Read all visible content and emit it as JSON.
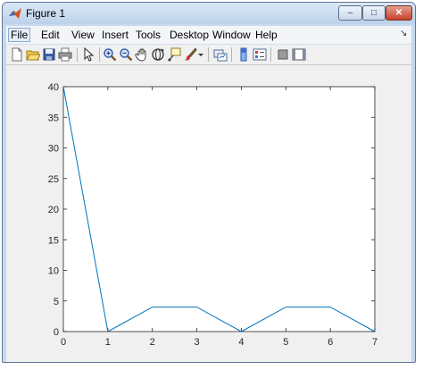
{
  "window": {
    "title": "Figure 1",
    "controls": {
      "minimize": "–",
      "maximize": "□",
      "close": "✕"
    }
  },
  "menu": {
    "items": [
      "File",
      "Edit",
      "View",
      "Insert",
      "Tools",
      "Desktop",
      "Window",
      "Help"
    ],
    "active": "File"
  },
  "toolbar": {
    "icons": [
      "new-figure-icon",
      "open-file-icon",
      "save-icon",
      "print-icon",
      "edit-plot-icon",
      "zoom-in-icon",
      "zoom-out-icon",
      "pan-icon",
      "rotate-3d-icon",
      "data-cursor-icon",
      "brush-icon",
      "brush-dropdown-icon",
      "link-plot-icon",
      "insert-colorbar-icon",
      "insert-legend-icon",
      "hide-plot-tools-icon",
      "show-plot-tools-icon"
    ]
  },
  "chart_data": {
    "type": "line",
    "x": [
      0,
      1,
      2,
      3,
      4,
      5,
      6,
      7
    ],
    "series": [
      {
        "values": [
          40,
          0,
          4,
          4,
          0,
          4,
          4,
          0
        ],
        "color": "#0072bd"
      }
    ],
    "xlim": [
      0,
      7
    ],
    "ylim": [
      0,
      40
    ],
    "xticks": [
      0,
      1,
      2,
      3,
      4,
      5,
      6,
      7
    ],
    "yticks": [
      0,
      5,
      10,
      15,
      20,
      25,
      30,
      35,
      40
    ],
    "grid": false,
    "title": "",
    "xlabel": "",
    "ylabel": ""
  }
}
